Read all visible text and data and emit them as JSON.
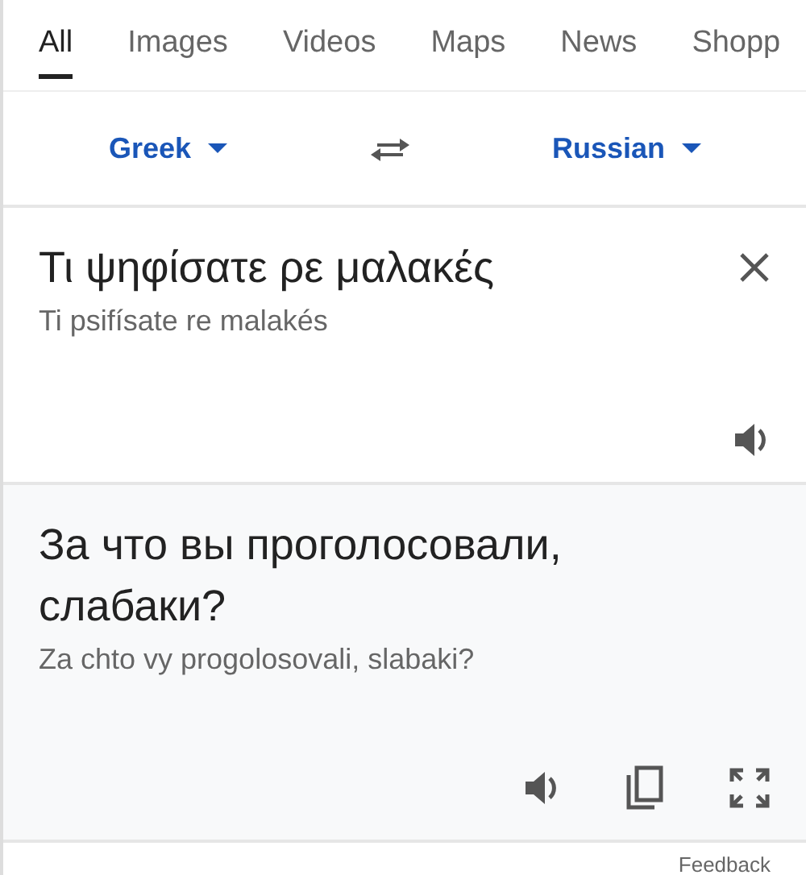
{
  "tabs": [
    {
      "label": "All",
      "selected": true
    },
    {
      "label": "Images",
      "selected": false
    },
    {
      "label": "Videos",
      "selected": false
    },
    {
      "label": "Maps",
      "selected": false
    },
    {
      "label": "News",
      "selected": false
    },
    {
      "label": "Shopp",
      "selected": false
    }
  ],
  "languages": {
    "source": "Greek",
    "target": "Russian"
  },
  "source": {
    "text": "Τι ψηφίσατε ρε μαλακές",
    "transliteration": "Ti psifísate re malakés"
  },
  "result": {
    "text": "За что вы проголосовали, слабаки?",
    "transliteration": "Za chto vy progolosovali, slabaki?"
  },
  "footer": {
    "link": "Feedback"
  }
}
